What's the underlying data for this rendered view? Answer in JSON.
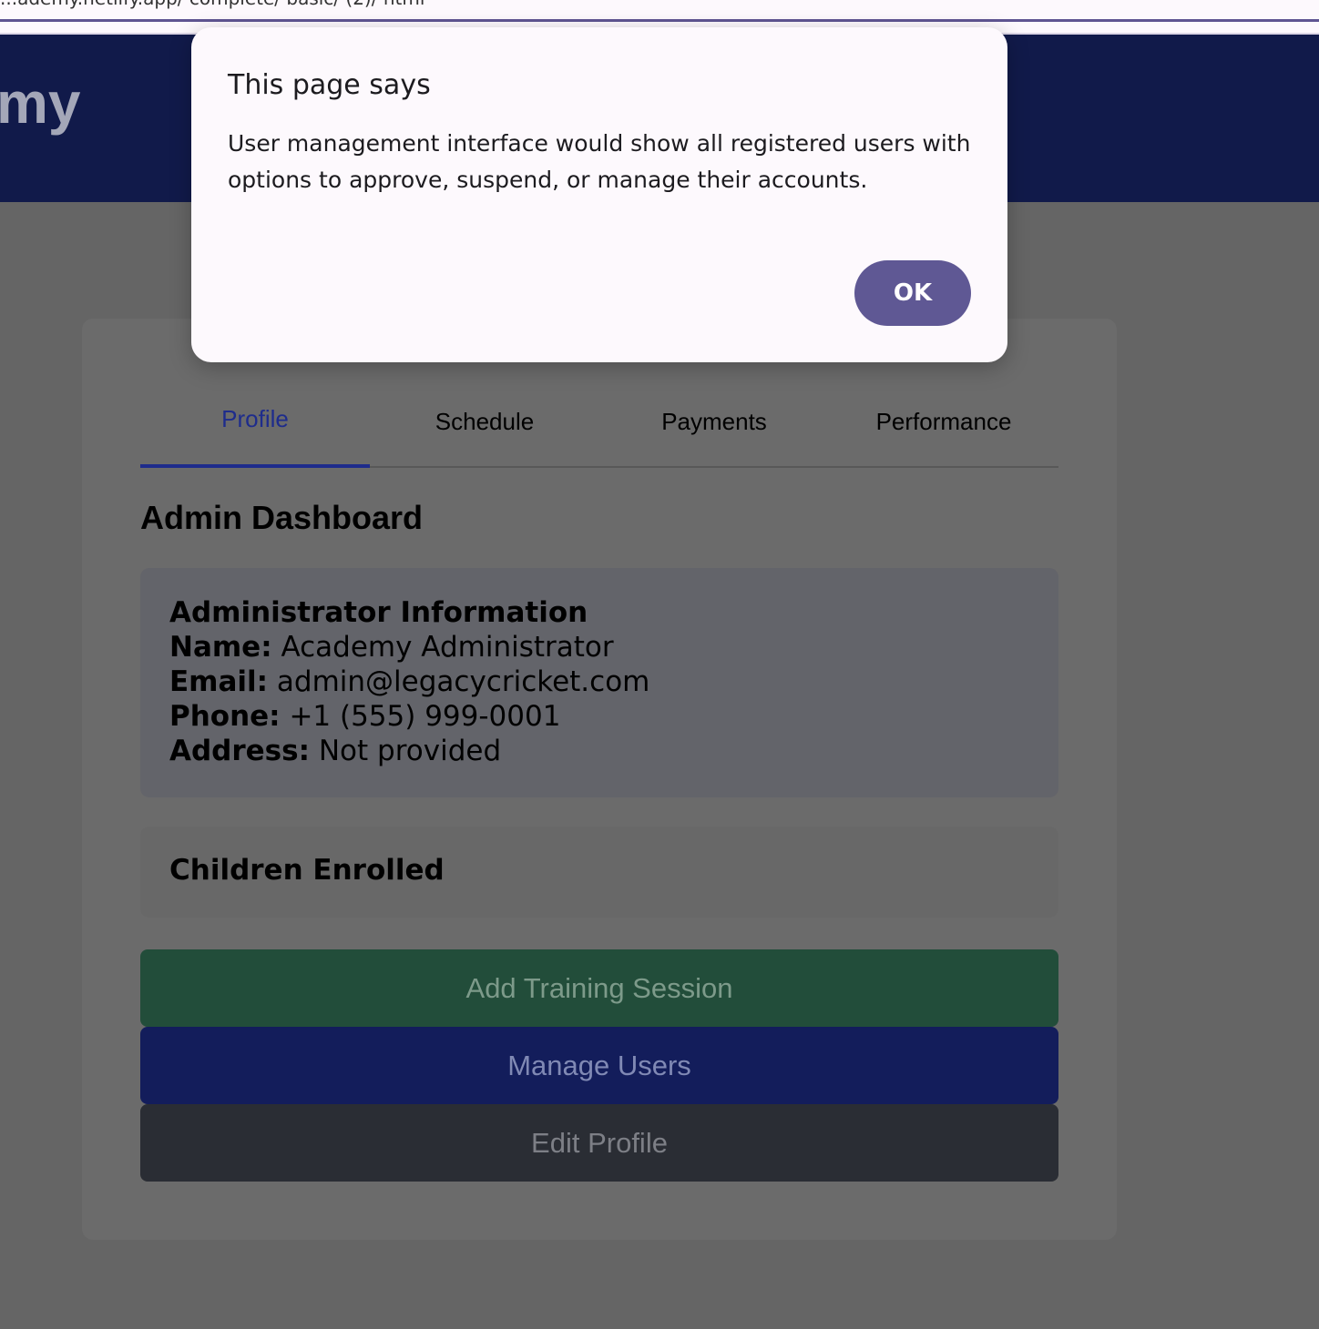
{
  "browser": {
    "url_fragment": "...ademy.netlify.app/ complete/ basic/ (2)/ html"
  },
  "header": {
    "brand_fragment": "my"
  },
  "tabs": [
    {
      "label": "Profile",
      "active": true
    },
    {
      "label": "Schedule",
      "active": false
    },
    {
      "label": "Payments",
      "active": false
    },
    {
      "label": "Performance",
      "active": false
    }
  ],
  "dashboard": {
    "title": "Admin Dashboard",
    "admin_info": {
      "heading": "Administrator Information",
      "name_label": "Name:",
      "name": "Academy Administrator",
      "email_label": "Email:",
      "email": "admin@legacycricket.com",
      "phone_label": "Phone:",
      "phone": "+1 (555) 999-0001",
      "address_label": "Address:",
      "address": "Not provided"
    },
    "children_heading": "Children Enrolled",
    "buttons": {
      "add_training": "Add Training Session",
      "manage_users": "Manage Users",
      "edit_profile": "Edit Profile"
    }
  },
  "dialog": {
    "title": "This page says",
    "message": "User management interface would show all registered users with options to approve, suspend, or manage their accounts.",
    "ok_label": "OK"
  },
  "colors": {
    "header_bg": "#111a4a",
    "active_tab": "#1e2c8c",
    "green_button": "#224d3a",
    "blue_button": "#131d5b",
    "dark_button": "#2a2d34",
    "dialog_ok": "#5f5894"
  }
}
